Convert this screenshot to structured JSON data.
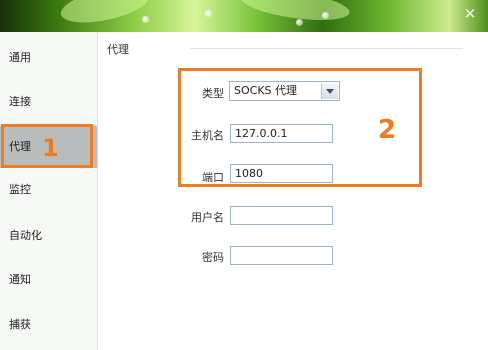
{
  "window": {
    "close_glyph": "×",
    "close_icon": "close-icon"
  },
  "sidebar": {
    "items": [
      {
        "label": "通用"
      },
      {
        "label": "连接"
      },
      {
        "label": "代理",
        "active": true,
        "annotation": "1"
      },
      {
        "label": "监控"
      },
      {
        "label": "自动化"
      },
      {
        "label": "通知"
      },
      {
        "label": "捕获"
      }
    ]
  },
  "main": {
    "section_title": "代理",
    "fields": {
      "type": {
        "label": "类型",
        "value": "SOCKS 代理"
      },
      "host": {
        "label": "主机名",
        "value": "127.0.0.1"
      },
      "port": {
        "label": "端口",
        "value": "1080"
      },
      "username": {
        "label": "用户名",
        "value": ""
      },
      "password": {
        "label": "密码",
        "value": ""
      }
    },
    "annotation": "2"
  },
  "colors": {
    "highlight": "#ef7b22",
    "active_nav": "#b9bcbd",
    "field_border": "#9db5c9"
  }
}
